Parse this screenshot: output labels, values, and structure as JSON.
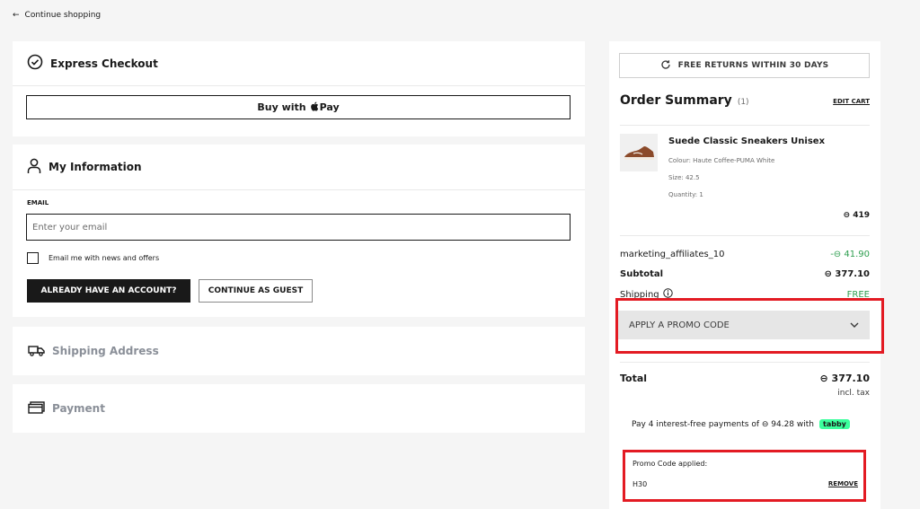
{
  "nav": {
    "back_label": "Continue shopping"
  },
  "express": {
    "title": "Express Checkout",
    "apple_pay_prefix": "Buy with",
    "apple_pay_suffix": "Pay"
  },
  "info": {
    "title": "My Information",
    "email_label": "EMAIL",
    "email_placeholder": "Enter your email",
    "newsletter_label": "Email me with news and offers",
    "account_button": "ALREADY HAVE AN ACCOUNT?",
    "guest_button": "CONTINUE AS GUEST"
  },
  "shipping": {
    "title": "Shipping Address"
  },
  "payment": {
    "title": "Payment"
  },
  "summary": {
    "free_returns": "FREE RETURNS WITHIN 30 DAYS",
    "title": "Order Summary",
    "count": "(1)",
    "edit_cart": "EDIT CART",
    "product": {
      "name": "Suede Classic Sneakers Unisex",
      "colour": "Colour: Haute Coffee-PUMA White",
      "size": "Size: 42.5",
      "quantity": "Quantity: 1",
      "price": "⊖ 419"
    },
    "discount_label": "marketing_affiliates_10",
    "discount_value": "-⊖ 41.90",
    "subtotal_label": "Subtotal",
    "subtotal_value": "⊖ 377.10",
    "shipping_label": "Shipping",
    "shipping_value": "FREE",
    "promo_dropdown": "APPLY A PROMO CODE",
    "total_label": "Total",
    "total_value": "⊖ 377.10",
    "incl_tax": "incl. tax",
    "installments": "Pay 4 interest-free payments of ⊖ 94.28 with",
    "tabby": "tabby",
    "promo_applied_label": "Promo Code applied:",
    "promo_code": "H30",
    "remove": "REMOVE"
  },
  "colors": {
    "highlight": "#e31b23",
    "discount": "#2e9e4f",
    "tabby": "#3bff9d"
  }
}
